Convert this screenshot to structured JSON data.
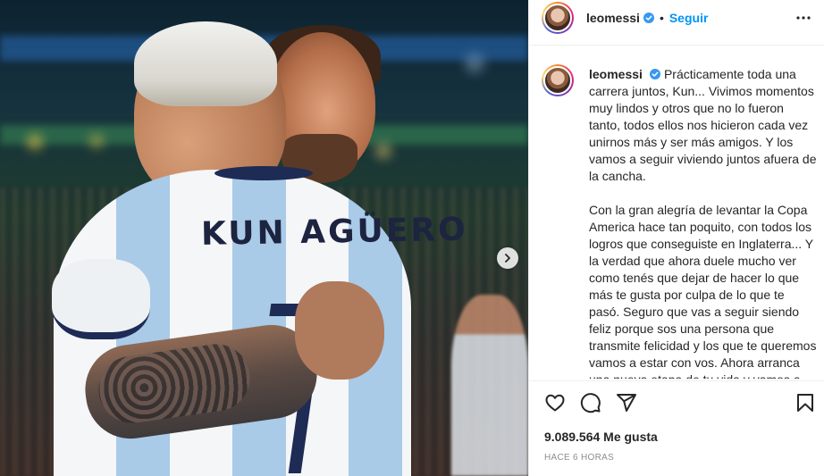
{
  "photo": {
    "shirt_name": "KUN AGÜERO",
    "next_icon": "chevron-right-icon"
  },
  "header": {
    "username": "leomessi",
    "separator": "•",
    "follow_label": "Seguir",
    "more_icon": "more-horizontal-icon"
  },
  "caption": {
    "username": "leomessi",
    "text": "Prácticamente toda una carrera juntos, Kun... Vivimos momentos muy lindos y otros que no lo fueron tanto, todos ellos nos hicieron cada vez unirnos más y ser más amigos. Y los vamos a seguir viviendo juntos afuera de la cancha.\n\nCon la gran alegría de levantar la Copa America hace tan poquito, con todos los logros que conseguiste en Inglaterra... Y la verdad que ahora duele mucho ver como tenés que dejar de hacer lo que más te gusta por culpa de lo que te pasó. Seguro que vas a seguir siendo feliz porque sos una persona que transmite felicidad y los que te queremos vamos a estar con vos. Ahora arranca una nueva etapa de tu vida y vamos a seguir juntos como siempre."
  },
  "actions": {
    "like_icon": "heart-icon",
    "comment_icon": "comment-icon",
    "share_icon": "send-icon",
    "save_icon": "bookmark-icon"
  },
  "likes": "9.089.564 Me gusta",
  "timestamp": "HACE 6 HORAS",
  "colors": {
    "follow_blue": "#0095f6",
    "verified_blue": "#3897f0",
    "text": "#262626",
    "muted": "#8e8e8e"
  }
}
